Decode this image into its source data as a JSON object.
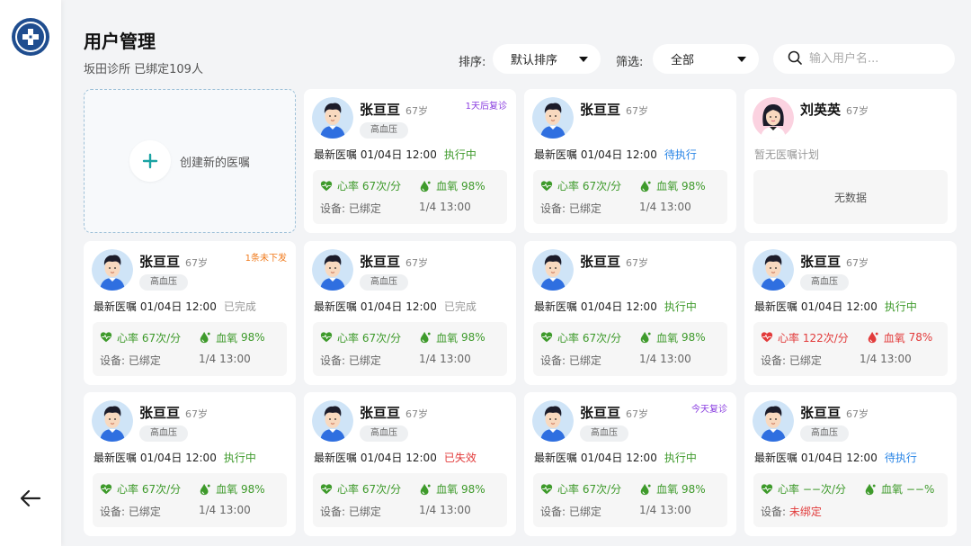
{
  "header": {
    "title": "用户管理",
    "subtitle": "坂田诊所 已绑定109人"
  },
  "toolbar": {
    "sort_label": "排序:",
    "sort_value": "默认排序",
    "filter_label": "筛选:",
    "filter_value": "全部",
    "search_placeholder": "输入用户名..."
  },
  "create": {
    "label": "创建新的医嘱"
  },
  "labels": {
    "order_prefix": "最新医嘱",
    "heart_prefix": "心率",
    "oxygen_prefix": "血氧",
    "device_prefix": "设备:",
    "no_plan": "暂无医嘱计划",
    "no_data": "无数据"
  },
  "colors": {
    "green": "#3e9a2b",
    "red": "#e23b3b",
    "blue": "#2b86e6",
    "orange": "#f07a1c",
    "purple": "#8a3ee0",
    "gray": "#999999"
  },
  "cards": [
    {
      "name": "张亘亘",
      "age": "67岁",
      "tag": "高血压",
      "badge": "1天后复诊",
      "badge_color": "purple",
      "order_time": "01/04日 12:00",
      "status": "执行中",
      "status_color": "green",
      "heart": "67次/分",
      "oxygen": "98%",
      "vital_color": "green",
      "device": "已绑定",
      "device_color": "gray",
      "time": "1/4 13:00",
      "avatar": "male"
    },
    {
      "name": "张亘亘",
      "age": "67岁",
      "tag": "",
      "badge": "",
      "badge_color": "gray",
      "order_time": "01/04日 12:00",
      "status": "待执行",
      "status_color": "blue",
      "heart": "67次/分",
      "oxygen": "98%",
      "vital_color": "green",
      "device": "已绑定",
      "device_color": "gray",
      "time": "1/4 13:00",
      "avatar": "male"
    },
    {
      "name": "刘英英",
      "age": "67岁",
      "tag": "",
      "badge": "",
      "badge_color": "gray",
      "empty": true,
      "avatar": "female"
    },
    {
      "name": "张亘亘",
      "age": "67岁",
      "tag": "高血压",
      "badge": "1条未下发",
      "badge_color": "orange",
      "order_time": "01/04日 12:00",
      "status": "已完成",
      "status_color": "gray",
      "heart": "67次/分",
      "oxygen": "98%",
      "vital_color": "green",
      "device": "已绑定",
      "device_color": "gray",
      "time": "1/4 13:00",
      "avatar": "male"
    },
    {
      "name": "张亘亘",
      "age": "67岁",
      "tag": "高血压",
      "badge": "",
      "badge_color": "gray",
      "order_time": "01/04日 12:00",
      "status": "已完成",
      "status_color": "gray",
      "heart": "67次/分",
      "oxygen": "98%",
      "vital_color": "green",
      "device": "已绑定",
      "device_color": "gray",
      "time": "1/4 13:00",
      "avatar": "male"
    },
    {
      "name": "张亘亘",
      "age": "67岁",
      "tag": "",
      "badge": "",
      "badge_color": "gray",
      "order_time": "01/04日 12:00",
      "status": "执行中",
      "status_color": "green",
      "heart": "67次/分",
      "oxygen": "98%",
      "vital_color": "green",
      "device": "已绑定",
      "device_color": "gray",
      "time": "1/4 13:00",
      "avatar": "male"
    },
    {
      "name": "张亘亘",
      "age": "67岁",
      "tag": "高血压",
      "badge": "",
      "badge_color": "gray",
      "order_time": "01/04日 12:00",
      "status": "执行中",
      "status_color": "green",
      "heart": "122次/分",
      "oxygen": "78%",
      "vital_color": "red",
      "device": "已绑定",
      "device_color": "gray",
      "time": "1/4 13:00",
      "avatar": "male"
    },
    {
      "name": "张亘亘",
      "age": "67岁",
      "tag": "高血压",
      "badge": "",
      "badge_color": "gray",
      "order_time": "01/04日 12:00",
      "status": "执行中",
      "status_color": "green",
      "heart": "67次/分",
      "oxygen": "98%",
      "vital_color": "green",
      "device": "已绑定",
      "device_color": "gray",
      "time": "1/4 13:00",
      "avatar": "male"
    },
    {
      "name": "张亘亘",
      "age": "67岁",
      "tag": "高血压",
      "badge": "",
      "badge_color": "gray",
      "order_time": "01/04日 12:00",
      "status": "已失效",
      "status_color": "red",
      "heart": "67次/分",
      "oxygen": "98%",
      "vital_color": "green",
      "device": "已绑定",
      "device_color": "gray",
      "time": "1/4 13:00",
      "avatar": "male"
    },
    {
      "name": "张亘亘",
      "age": "67岁",
      "tag": "高血压",
      "badge": "今天复诊",
      "badge_color": "purple",
      "order_time": "01/04日 12:00",
      "status": "执行中",
      "status_color": "green",
      "heart": "67次/分",
      "oxygen": "98%",
      "vital_color": "green",
      "device": "已绑定",
      "device_color": "gray",
      "time": "1/4 13:00",
      "avatar": "male"
    },
    {
      "name": "张亘亘",
      "age": "67岁",
      "tag": "高血压",
      "badge": "",
      "badge_color": "gray",
      "order_time": "01/04日 12:00",
      "status": "待执行",
      "status_color": "blue",
      "heart": "−−次/分",
      "oxygen": "−−%",
      "vital_color": "green",
      "device": "未绑定",
      "device_color": "red",
      "time": "",
      "avatar": "male"
    }
  ]
}
